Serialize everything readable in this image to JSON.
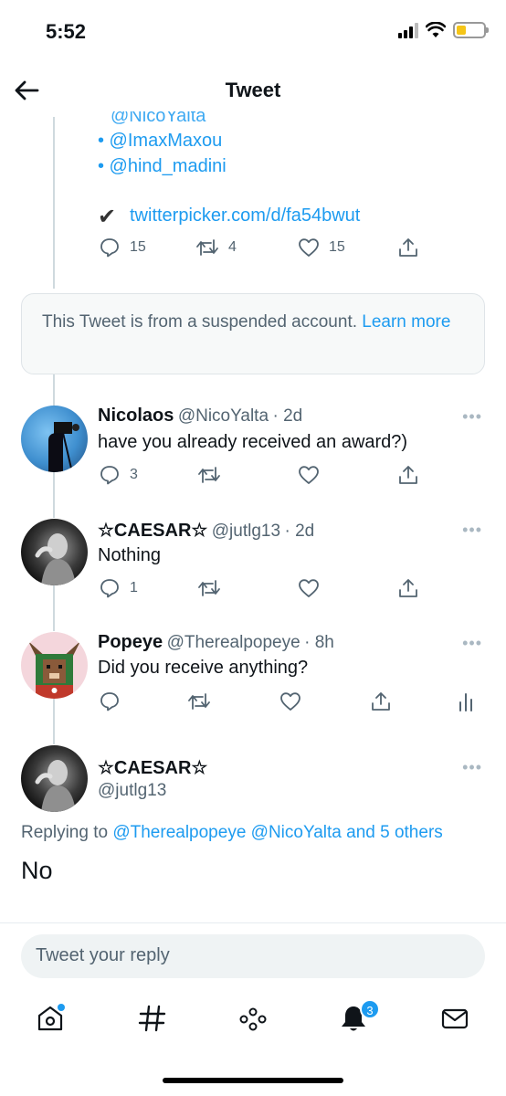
{
  "status_bar": {
    "time": "5:52"
  },
  "header": {
    "title": "Tweet"
  },
  "prev_tweet": {
    "partial_mention": "@NicoYalta",
    "mentions": [
      "• @ImaxMaxou",
      "• @hind_madini"
    ],
    "link_check": "✔",
    "link": "twitterpicker.com/d/fa54bwut",
    "reply_count": "15",
    "retweet_count": "4",
    "like_count": "15"
  },
  "notice": {
    "text": "This Tweet is from a suspended account.",
    "link": "Learn more"
  },
  "replies": [
    {
      "name": "Nicolaos",
      "handle": "@NicoYalta",
      "time": "· 2d",
      "text": "have you already received an award?)",
      "reply_count": "3"
    },
    {
      "name": "☆CAESAR☆",
      "handle": "@jutlg13",
      "time": "· 2d",
      "text": "Nothing",
      "reply_count": "1"
    },
    {
      "name": "Popeye",
      "handle": "@Therealpopeye",
      "time": "· 8h",
      "text": "Did you receive anything?"
    }
  ],
  "main_tweet": {
    "name": "☆CAESAR☆",
    "handle": "@jutlg13",
    "replying_prefix": "Replying to",
    "replying_to": "@Therealpopeye @NicoYalta and 5 others",
    "text": "No"
  },
  "reply_box": {
    "placeholder": "Tweet your reply"
  },
  "nav": {
    "notifications_badge": "3"
  },
  "more_label": "•••",
  "colors": {
    "accent": "#1d9bf0",
    "secondary": "#536471"
  }
}
